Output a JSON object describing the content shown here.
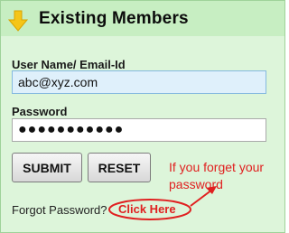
{
  "header": {
    "title": "Existing Members",
    "icon": "down-arrow-icon",
    "icon_color": "#f5c518"
  },
  "username": {
    "label": "User Name/ Email-Id",
    "value": "abc@xyz.com"
  },
  "password": {
    "label": "Password",
    "value": "●●●●●●●●●●●"
  },
  "buttons": {
    "submit": "SUBMIT",
    "reset": "RESET"
  },
  "annotation": {
    "hint": "If you forget your password",
    "color": "#e02020"
  },
  "forgot": {
    "text": "Forgot Password?",
    "link": "Click Here"
  }
}
